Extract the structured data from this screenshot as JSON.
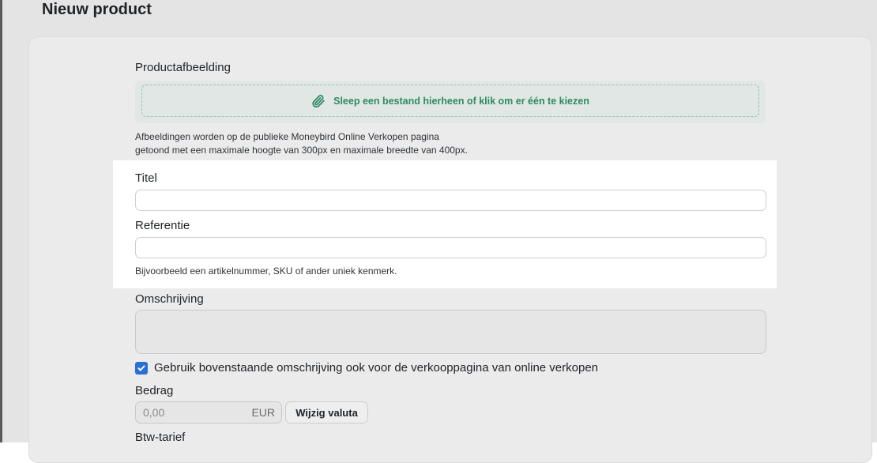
{
  "header": {
    "title": "Nieuw product"
  },
  "image_section": {
    "label": "Productafbeelding",
    "dropzone_text": "Sleep een bestand hierheen of klik om er één te kiezen",
    "hint_line1": "Afbeeldingen worden op de publieke Moneybird Online Verkopen pagina",
    "hint_line2": "getoond met een maximale hoogte van 300px en maximale breedte van 400px."
  },
  "title_field": {
    "label": "Titel",
    "value": ""
  },
  "reference_field": {
    "label": "Referentie",
    "value": "",
    "hint": "Bijvoorbeeld een artikelnummer, SKU of ander uniek kenmerk."
  },
  "description_field": {
    "label": "Omschrijving",
    "value": ""
  },
  "online_sales_checkbox": {
    "checked": true,
    "label": "Gebruik bovenstaande omschrijving ook voor de verkooppagina van online verkopen"
  },
  "amount_field": {
    "label": "Bedrag",
    "placeholder": "0,00",
    "currency": "EUR",
    "change_currency_label": "Wijzig valuta"
  },
  "vat_field": {
    "label": "Btw-tarief"
  },
  "colors": {
    "accent_green": "#2f8a67",
    "checkbox_blue": "#2b6fd6"
  }
}
